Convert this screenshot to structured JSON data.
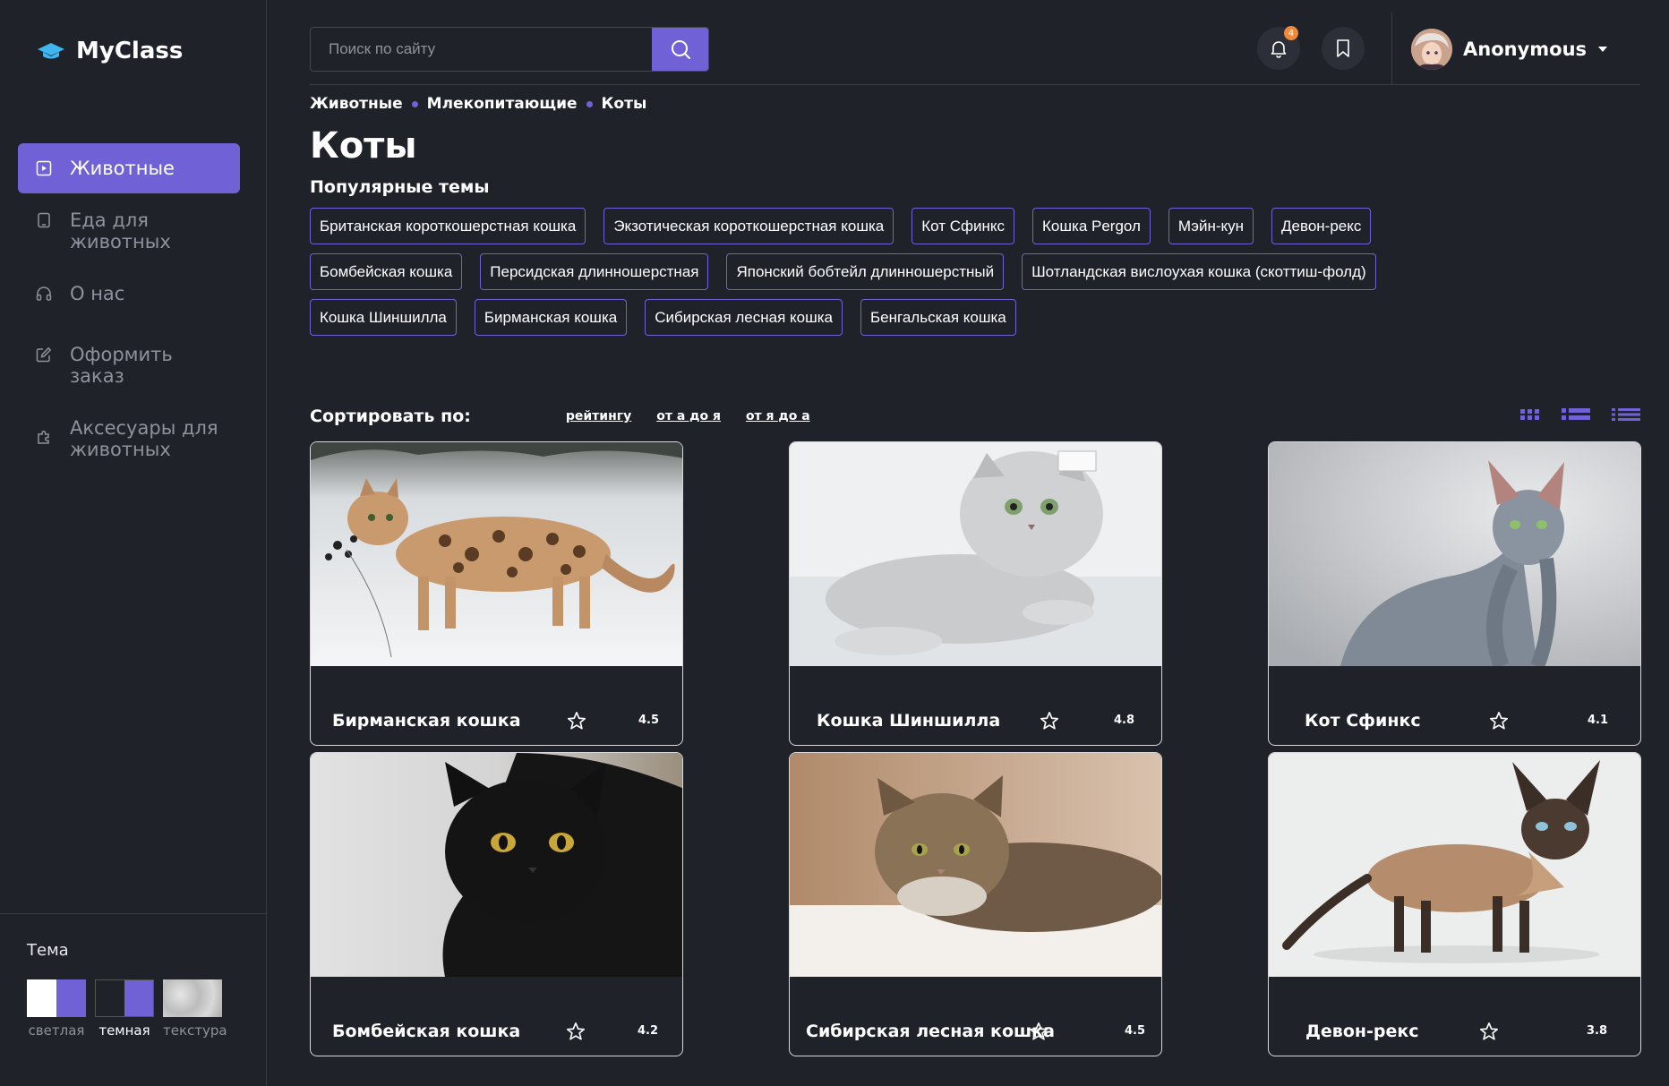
{
  "app": {
    "logo_text": "MyClass"
  },
  "sidebar": {
    "items": [
      {
        "label": "Животные",
        "icon": "play-square-icon",
        "active": true
      },
      {
        "label": "Еда для животных",
        "icon": "tablet-icon",
        "active": false
      },
      {
        "label": "О нас",
        "icon": "headphones-icon",
        "active": false
      },
      {
        "label": "Оформить заказ",
        "icon": "edit-icon",
        "active": false
      },
      {
        "label": "Аксесуары для животных",
        "icon": "puzzle-icon",
        "active": false
      }
    ],
    "theme": {
      "title": "Тема",
      "options": [
        {
          "label": "светлая",
          "selected": false
        },
        {
          "label": "темная",
          "selected": true
        },
        {
          "label": "текстура",
          "selected": false
        }
      ]
    }
  },
  "header": {
    "search_placeholder": "Поиск по сайту",
    "notifications_count": "4",
    "user_name": "Anonymous"
  },
  "breadcrumb": [
    "Животные",
    "Млекопитающие",
    "Коты"
  ],
  "page_title": "Коты",
  "popular": {
    "title": "Популярные темы",
    "tags": [
      "Британская короткошерстная кошка",
      "Экзотическая короткошерстная кошка",
      "Кот Сфинкс",
      "Кошка Pergол",
      "Мэйн-кун",
      "Девон-рекс",
      "Бомбейская кошка",
      "Персидская длинношерстная",
      "Японский бобтейл длинношерстный",
      "Шотландская вислоухая кошка (скоттиш-фолд)",
      "Кошка Шиншилла",
      "Бирманская кошка",
      "Сибирская лесная кошка",
      "Бенгальская кошка"
    ]
  },
  "sort": {
    "title": "Сортировать по:",
    "options": [
      "рейтингу",
      "от а до я",
      "от я до а"
    ]
  },
  "cards": [
    {
      "title": "Бирманская кошка",
      "rating": "4.5"
    },
    {
      "title": "Кошка Шиншилла",
      "rating": "4.8"
    },
    {
      "title": "Кот Сфинкс",
      "rating": "4.1"
    },
    {
      "title": "Бомбейская кошка",
      "rating": "4.2"
    },
    {
      "title": "Сибирская лесная кошка",
      "rating": "4.5"
    },
    {
      "title": "Девон-рекс",
      "rating": "3.8"
    }
  ],
  "colors": {
    "accent": "#7062d6",
    "background": "#1f2229",
    "badge": "#f08a3b"
  }
}
